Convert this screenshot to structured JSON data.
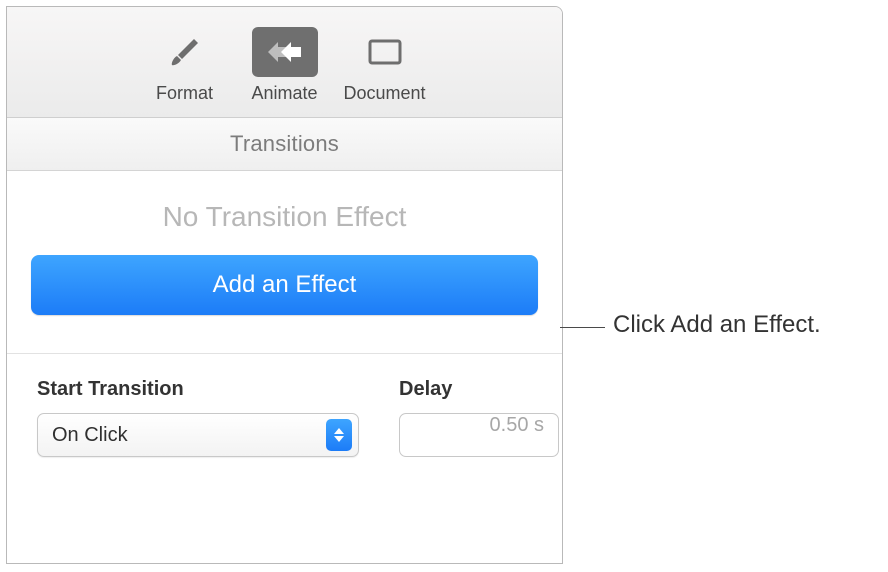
{
  "toolbar": {
    "tabs": [
      {
        "label": "Format"
      },
      {
        "label": "Animate"
      },
      {
        "label": "Document"
      }
    ]
  },
  "section": {
    "title": "Transitions"
  },
  "content": {
    "status": "No Transition Effect",
    "add_effect": "Add an Effect",
    "start_label": "Start Transition",
    "start_value": "On Click",
    "delay_label": "Delay",
    "delay_value": "0.50 s"
  },
  "callout": "Click Add an Effect."
}
